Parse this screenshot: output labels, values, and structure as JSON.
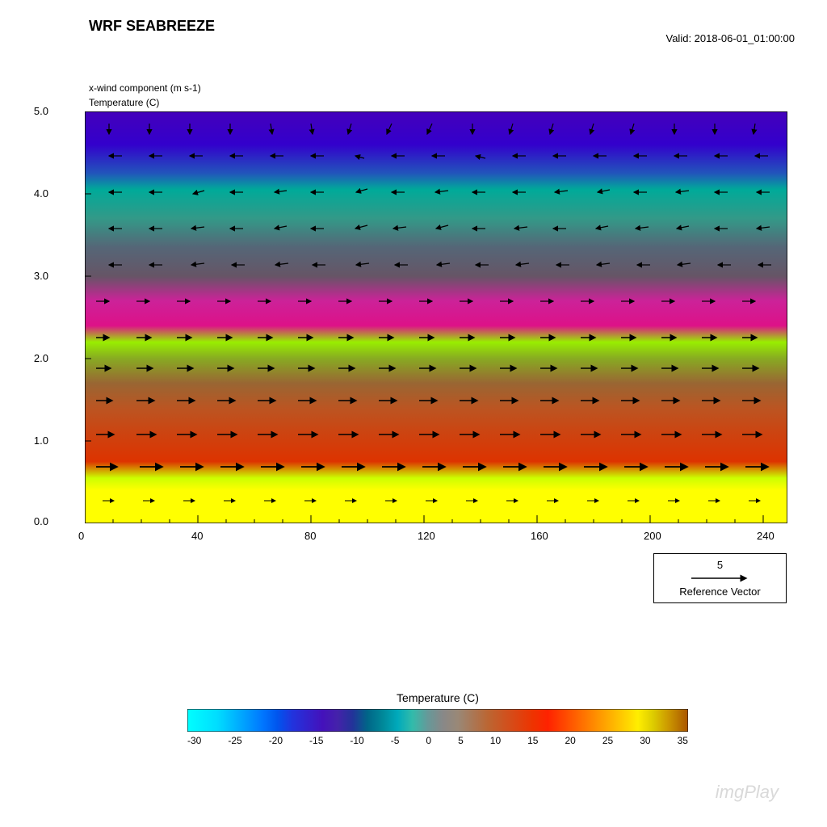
{
  "header": {
    "title": "WRF SEABREEZE",
    "valid_time": "Valid: 2018-06-01_01:00:00"
  },
  "y_axis": {
    "label_line1": "x-wind component   (m s-1)",
    "label_line2": "Temperature   (C)",
    "ticks": [
      "5.0",
      "4.0",
      "3.0",
      "2.0",
      "1.0",
      "0.0"
    ]
  },
  "x_axis": {
    "ticks": [
      "0",
      "40",
      "80",
      "120",
      "160",
      "200",
      "240"
    ]
  },
  "reference_vector": {
    "value": "5",
    "label": "Reference Vector"
  },
  "colorbar": {
    "title": "Temperature  (C)",
    "ticks": [
      "-30",
      "-25",
      "-20",
      "-15",
      "-10",
      "-5",
      "0",
      "5",
      "10",
      "15",
      "20",
      "25",
      "30",
      "35"
    ]
  },
  "watermark": "imgPlay"
}
